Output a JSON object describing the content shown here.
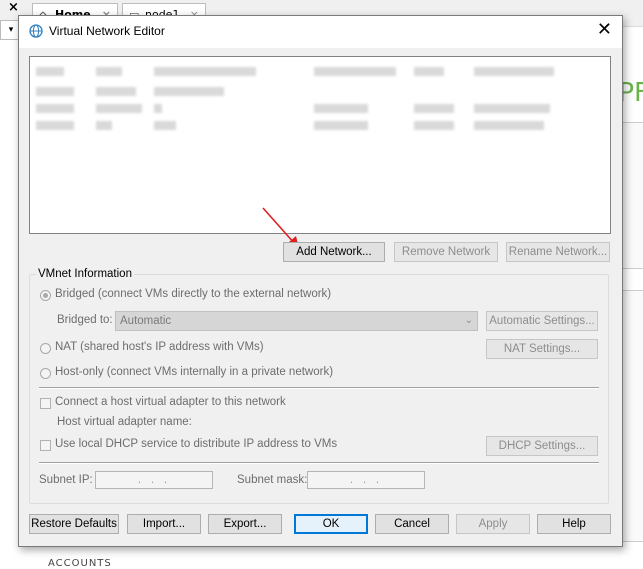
{
  "background": {
    "close_glyph": "×",
    "tab_home": "Home",
    "tab_node1": "node1",
    "tab_close": "×",
    "dropdown_glyph": "▾",
    "side_text": "PF",
    "bottom_text": "ACCOUNTS"
  },
  "dialog": {
    "title": "Virtual Network Editor",
    "close_glyph": "✕",
    "list_buttons": {
      "add": "Add Network...",
      "remove": "Remove Network",
      "rename": "Rename Network..."
    },
    "vmnet": {
      "group_title": "VMnet Information",
      "bridged_label": "Bridged (connect VMs directly to the external network)",
      "bridged_to_label": "Bridged to:",
      "bridged_to_value": "Automatic",
      "automatic_settings": "Automatic Settings...",
      "nat_label": "NAT (shared host's IP address with VMs)",
      "nat_settings": "NAT Settings...",
      "hostonly_label": "Host-only (connect VMs internally in a private network)",
      "connect_adapter_label": "Connect a host virtual adapter to this network",
      "adapter_name_label": "Host virtual adapter name:",
      "dhcp_label": "Use local DHCP service to distribute IP address to VMs",
      "dhcp_settings": "DHCP Settings...",
      "subnet_ip_label": "Subnet IP:",
      "subnet_mask_label": "Subnet mask:",
      "ip_dots": ". . .",
      "mask_dots": ". . ."
    },
    "footer": {
      "restore": "Restore Defaults",
      "import": "Import...",
      "export": "Export...",
      "ok": "OK",
      "cancel": "Cancel",
      "apply": "Apply",
      "help": "Help"
    }
  },
  "colors": {
    "accent": "#0078d7",
    "annotation_arrow": "#e02020",
    "brand_green": "#6bb44a"
  },
  "icons": [
    "network-globe-icon",
    "close-icon",
    "home-icon",
    "page-icon",
    "chevron-down-icon",
    "red-arrow-annotation"
  ]
}
